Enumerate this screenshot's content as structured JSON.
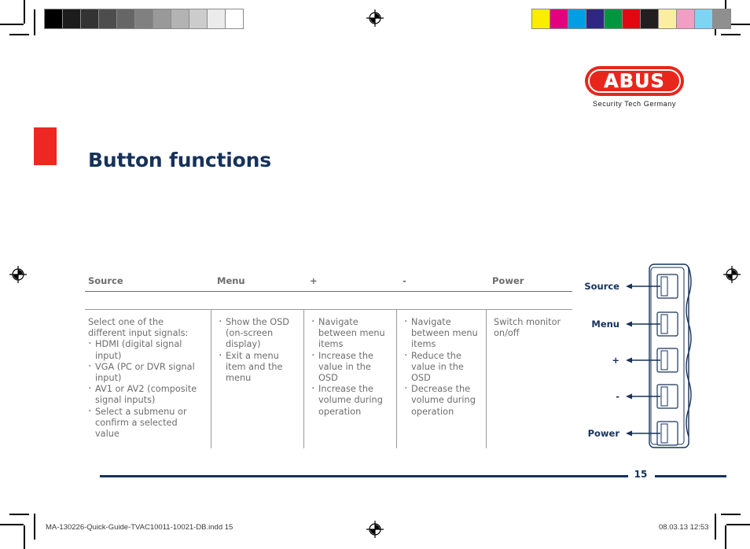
{
  "document": {
    "title": "Button functions",
    "page_number": "15",
    "footer_filename": "MA-130226-Quick-Guide-TVAC10011-10021-DB.indd   15",
    "footer_timestamp": "08.03.13   12:53"
  },
  "brand": {
    "name": "ABUS",
    "tagline": "Security Tech Germany",
    "logo_color": "#e8261c",
    "accent_color": "#ee2722",
    "heading_color": "#17325a"
  },
  "print_marks": {
    "grayscale_wedge": [
      "#000000",
      "#1c1c1c",
      "#333333",
      "#4d4d4d",
      "#666666",
      "#808080",
      "#999999",
      "#b3b3b3",
      "#cccccc",
      "#ebebeb",
      "#ffffff"
    ],
    "color_bar": [
      "#fced00",
      "#e5007d",
      "#009fe3",
      "#312783",
      "#009640",
      "#e30613",
      "#231f20",
      "#fbeea1",
      "#f29ec4",
      "#7fd4f4",
      "#8f8f8f"
    ],
    "registration_icon": "registration-target-icon"
  },
  "table": {
    "columns": [
      "Source",
      "Menu",
      "+",
      "-",
      "Power"
    ],
    "cells": [
      {
        "column": "Source",
        "lead": "Select one of the different input signals:",
        "bullets": [
          "HDMI (digital signal input)",
          "VGA (PC or DVR signal input)",
          "AV1 or AV2 (composite signal inputs)",
          "Select a submenu or confirm a selected value"
        ]
      },
      {
        "column": "Menu",
        "lead": "",
        "bullets": [
          "Show the OSD (on-screen display)",
          "Exit a menu item and the menu"
        ]
      },
      {
        "column": "+",
        "lead": "",
        "bullets": [
          "Navigate between menu items",
          "Increase the value in the OSD",
          "Increase the volume during operation"
        ]
      },
      {
        "column": "-",
        "lead": "",
        "bullets": [
          "Navigate between menu items",
          "Reduce the value in the OSD",
          "Decrease the volume during operation"
        ]
      },
      {
        "column": "Power",
        "lead": "Switch monitor on/off",
        "bullets": []
      }
    ]
  },
  "diagram": {
    "name": "monitor-side-panel-buttons",
    "buttons": [
      {
        "label": "Source"
      },
      {
        "label": "Menu"
      },
      {
        "label": "+"
      },
      {
        "label": "-"
      },
      {
        "label": "Power"
      }
    ]
  }
}
